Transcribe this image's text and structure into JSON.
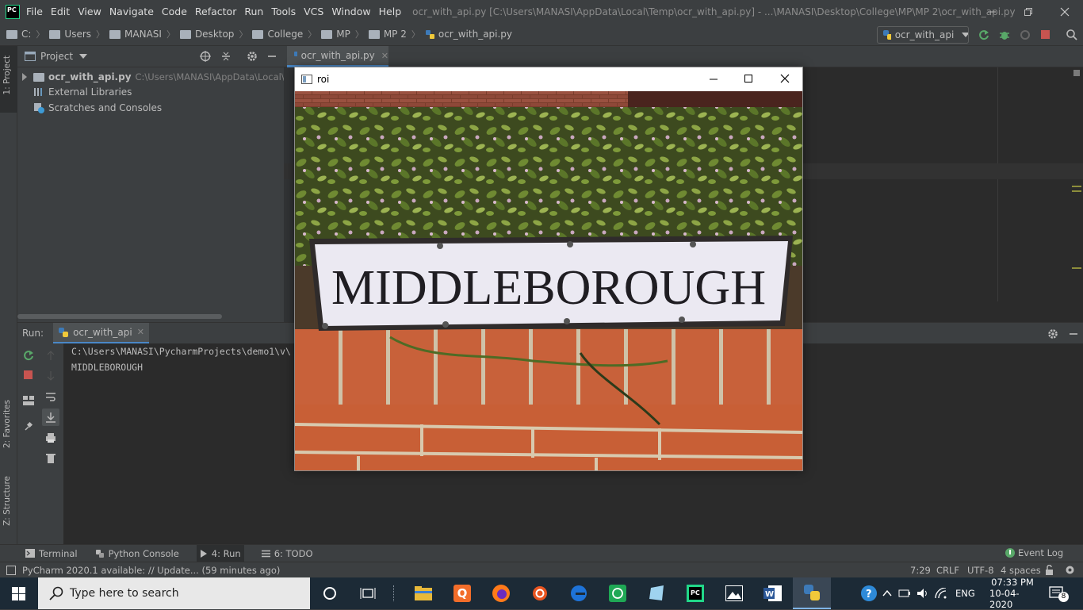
{
  "menu": {
    "items": [
      "File",
      "Edit",
      "View",
      "Navigate",
      "Code",
      "Refactor",
      "Run",
      "Tools",
      "VCS",
      "Window",
      "Help"
    ],
    "window_title": "ocr_with_api.py [C:\\Users\\MANASI\\AppData\\Local\\Temp\\ocr_with_api.py] - ...\\MANASI\\Desktop\\College\\MP\\MP 2\\ocr_with_api.py"
  },
  "breadcrumbs": [
    "C:",
    "Users",
    "MANASI",
    "Desktop",
    "College",
    "MP",
    "MP 2",
    "ocr_with_api.py"
  ],
  "run_config": "ocr_with_api",
  "sidebar": {
    "left_tabs": [
      "1: Project",
      "2: Favorites",
      "Z: Structure"
    ]
  },
  "project": {
    "header": "Project",
    "items": [
      {
        "label": "ocr_with_api.py",
        "path": "C:\\Users\\MANASI\\AppData\\Local\\Tem"
      },
      {
        "label": "External Libraries"
      },
      {
        "label": "Scratches and Consoles"
      }
    ]
  },
  "editor": {
    "tab": "ocr_with_api.py"
  },
  "run": {
    "label": "Run:",
    "tab": "ocr_with_api",
    "console": [
      "C:\\Users\\MANASI\\PycharmProjects\\demo1\\v\\",
      "MIDDLEBOROUGH"
    ]
  },
  "bottom_tabs": [
    {
      "label": "Terminal"
    },
    {
      "label": "Python Console"
    },
    {
      "label": "4: Run"
    },
    {
      "label": "6: TODO"
    }
  ],
  "event_log": "Event Log",
  "status": {
    "message": "PyCharm 2020.1 available: // Update... (59 minutes ago)",
    "position": "7:29",
    "line_sep": "CRLF",
    "encoding": "UTF-8",
    "indent": "4 spaces"
  },
  "roi_window": {
    "title": "roi",
    "sign_text": "MIDDLEBOROUGH"
  },
  "taskbar": {
    "search_placeholder": "Type here to search",
    "lang": "ENG",
    "time": "07:33 PM",
    "date": "10-04-2020",
    "notifications": "8"
  },
  "colors": {
    "ide_bg": "#3c3f41",
    "editor_bg": "#2b2b2b",
    "accent": "#4a88c7",
    "taskbar": "#1c2a36"
  }
}
